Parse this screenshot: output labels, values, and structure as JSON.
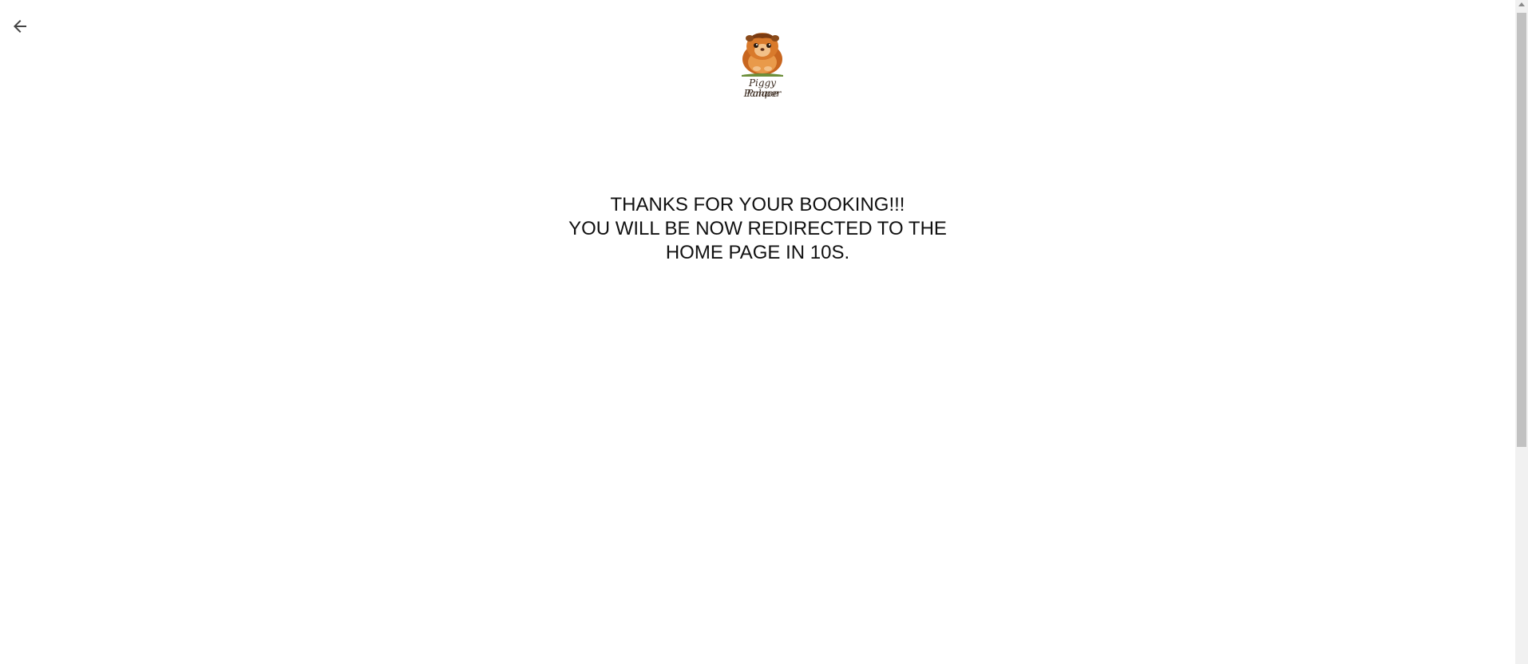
{
  "header": {
    "back_icon": "arrow-left-icon",
    "logo": {
      "text_line1": "Piggy Pamper",
      "text_line2": "Palace"
    }
  },
  "main": {
    "message_lines": [
      "THANKS FOR YOUR BOOKING!!!",
      "YOU WILL BE NOW REDIRECTED TO THE",
      "HOME PAGE IN 10S."
    ]
  },
  "colors": {
    "text": "#111111",
    "icon": "#444444",
    "logo_fur": "#d97a2b"
  }
}
